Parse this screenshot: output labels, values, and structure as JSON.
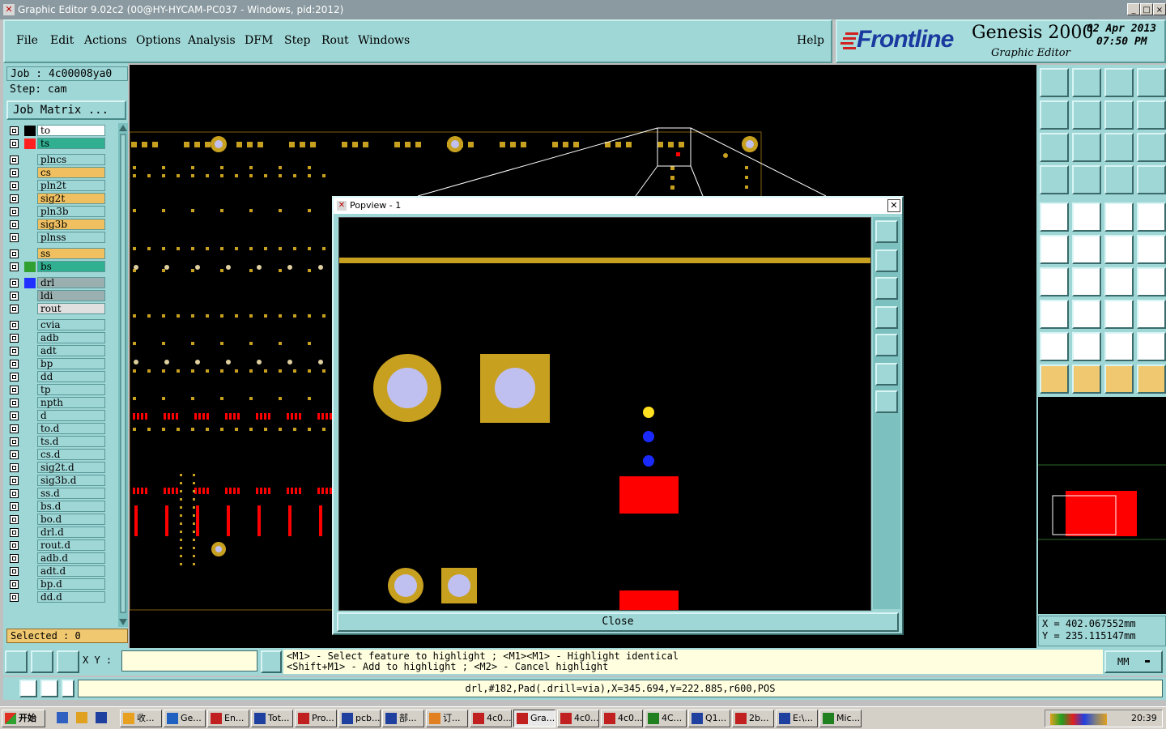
{
  "window": {
    "title": "Graphic Editor 9.02c2 (00@HY-HYCAM-PC037 - Windows, pid:2012)",
    "controls": [
      "_",
      "□",
      "×"
    ]
  },
  "menu": {
    "items": [
      "File",
      "Edit",
      "Actions",
      "Options",
      "Analysis",
      "DFM",
      "Step",
      "Rout",
      "Windows"
    ],
    "help": "Help"
  },
  "brand": {
    "logo": "Frontline",
    "product": "Genesis 2000",
    "subtitle": "Graphic Editor",
    "date": "02 Apr 2013",
    "time": "07:50 PM"
  },
  "job": {
    "job_label": "Job : 4c00008ya0",
    "step_label": "Step: cam",
    "matrix_button": "Job Matrix ...",
    "selected_label": "Selected : 0"
  },
  "layers": [
    {
      "name": "to",
      "color": "#000000",
      "bg": "#ffffff"
    },
    {
      "name": "ts",
      "color": "#ff2020",
      "bg": "#30b090"
    },
    {
      "name": "plncs",
      "color": "",
      "bg": "#9fd6d6"
    },
    {
      "name": "cs",
      "color": "",
      "bg": "#f0c060"
    },
    {
      "name": "pln2t",
      "color": "",
      "bg": "#9fd6d6"
    },
    {
      "name": "sig2t",
      "color": "",
      "bg": "#f0c060"
    },
    {
      "name": "pln3b",
      "color": "",
      "bg": "#9fd6d6"
    },
    {
      "name": "sig3b",
      "color": "",
      "bg": "#f0c060"
    },
    {
      "name": "plnss",
      "color": "",
      "bg": "#9fd6d6"
    },
    {
      "name": "ss",
      "color": "",
      "bg": "#f0c060"
    },
    {
      "name": "bs",
      "color": "#30a030",
      "bg": "#30b090"
    },
    {
      "name": "drl",
      "color": "#2030ff",
      "bg": "#9ab0b0"
    },
    {
      "name": "ldi",
      "color": "",
      "bg": "#9ab0b0"
    },
    {
      "name": "rout",
      "color": "",
      "bg": "#e0e0e0"
    },
    {
      "name": "cvia",
      "color": "",
      "bg": "#9fd6d6"
    },
    {
      "name": "adb",
      "color": "",
      "bg": "#9fd6d6"
    },
    {
      "name": "adt",
      "color": "",
      "bg": "#9fd6d6"
    },
    {
      "name": "bp",
      "color": "",
      "bg": "#9fd6d6"
    },
    {
      "name": "dd",
      "color": "",
      "bg": "#9fd6d6"
    },
    {
      "name": "tp",
      "color": "",
      "bg": "#9fd6d6"
    },
    {
      "name": "npth",
      "color": "",
      "bg": "#9fd6d6"
    },
    {
      "name": "d",
      "color": "",
      "bg": "#9fd6d6"
    },
    {
      "name": "to.d",
      "color": "",
      "bg": "#9fd6d6"
    },
    {
      "name": "ts.d",
      "color": "",
      "bg": "#9fd6d6"
    },
    {
      "name": "cs.d",
      "color": "",
      "bg": "#9fd6d6"
    },
    {
      "name": "sig2t.d",
      "color": "",
      "bg": "#9fd6d6"
    },
    {
      "name": "sig3b.d",
      "color": "",
      "bg": "#9fd6d6"
    },
    {
      "name": "ss.d",
      "color": "",
      "bg": "#9fd6d6"
    },
    {
      "name": "bs.d",
      "color": "",
      "bg": "#9fd6d6"
    },
    {
      "name": "bo.d",
      "color": "",
      "bg": "#9fd6d6"
    },
    {
      "name": "drl.d",
      "color": "",
      "bg": "#9fd6d6"
    },
    {
      "name": "rout.d",
      "color": "",
      "bg": "#9fd6d6"
    },
    {
      "name": "adb.d",
      "color": "",
      "bg": "#9fd6d6"
    },
    {
      "name": "adt.d",
      "color": "",
      "bg": "#9fd6d6"
    },
    {
      "name": "bp.d",
      "color": "",
      "bg": "#9fd6d6"
    },
    {
      "name": "dd.d",
      "color": "",
      "bg": "#9fd6d6"
    }
  ],
  "popview": {
    "title": "Popview - 1",
    "close_button": "Close"
  },
  "coords": {
    "x": "X  =  402.067552mm",
    "y": "Y  =  235.115147mm"
  },
  "command": {
    "xy_label": "X Y :",
    "xy_value": "",
    "hint_line1": "<M1> - Select feature to highlight ; <M1><M1> - Highlight identical",
    "hint_line2": "<Shift+M1> - Add to highlight ; <M2> - Cancel highlight",
    "units": "MM"
  },
  "status": {
    "text": "drl,#182,Pad(.drill=via),X=345.694,Y=222.885,r600,POS"
  },
  "taskbar": {
    "start": "开始",
    "tasks": [
      "收...",
      "Ge...",
      "En...",
      "Tot...",
      "Pro...",
      "pcb...",
      "部...",
      "订...",
      "4c0...",
      "Gra...",
      "4c0...",
      "4c0...",
      "4C...",
      "Q1...",
      "2b...",
      "E:\\...",
      "Mic..."
    ],
    "active_index": 9,
    "clock": "20:39"
  },
  "colors": {
    "panel": "#9fd6d6",
    "copper": "#c8a020",
    "drill": "#c0c0f0",
    "solder_red": "#ff0000",
    "via_blue": "#1a2aff",
    "marker_yellow": "#ffe020"
  }
}
